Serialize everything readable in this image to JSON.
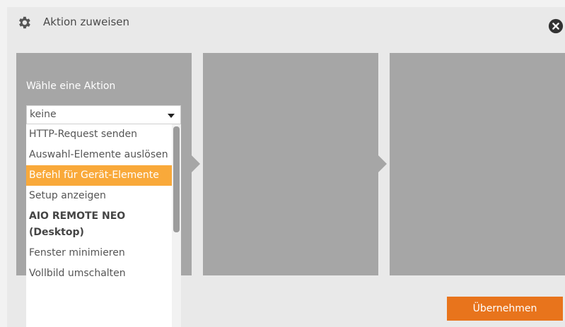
{
  "dialog": {
    "title": "Aktion zuweisen",
    "icons": {
      "settings": "gear-icon",
      "close": "close-icon"
    }
  },
  "panel1": {
    "label": "Wähle eine Aktion",
    "select": {
      "value": "keine",
      "options": [
        {
          "label": "HTTP-Request senden"
        },
        {
          "label": "Auswahl-Elemente auslösen"
        },
        {
          "label": "Befehl für Gerät-Elemente",
          "selected": true
        },
        {
          "label": "Setup anzeigen"
        },
        {
          "label": "AIO REMOTE NEO (Desktop)",
          "bold": true
        },
        {
          "label": "Fenster minimieren"
        },
        {
          "label": "Vollbild umschalten"
        }
      ]
    }
  },
  "footer": {
    "apply_label": "Übernehmen"
  },
  "colors": {
    "accent": "#e8741c",
    "highlight": "#f9a93a",
    "panel": "#a6a6a6"
  }
}
